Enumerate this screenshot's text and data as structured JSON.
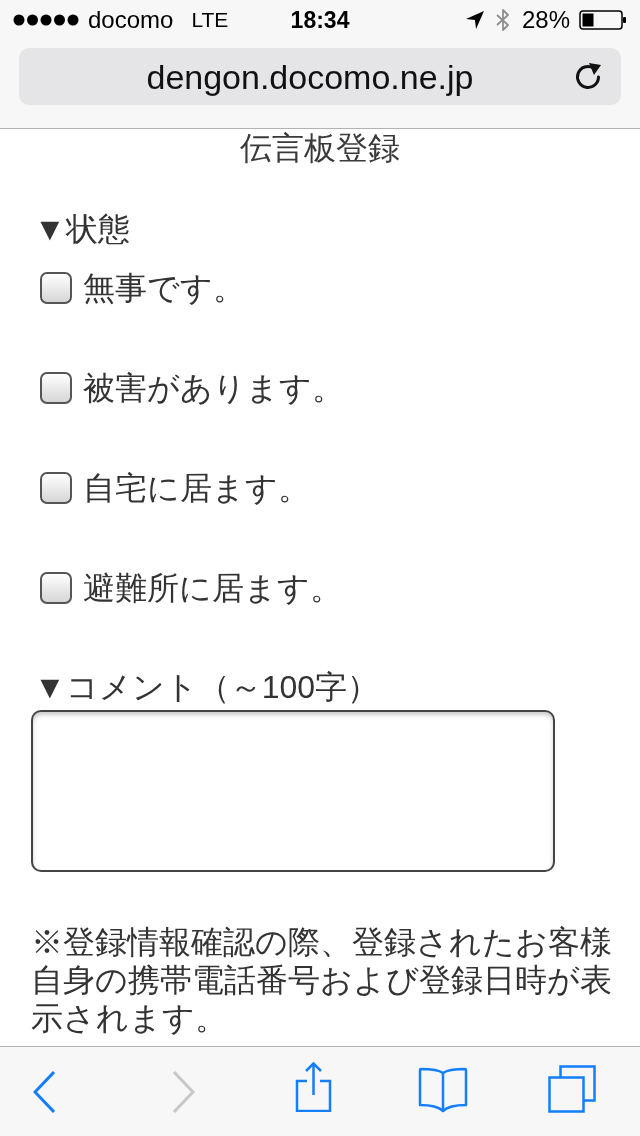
{
  "status_bar": {
    "carrier": "docomo",
    "network": "LTE",
    "time": "18:34",
    "battery": "28%"
  },
  "address_bar": {
    "url": "dengon.docomo.ne.jp"
  },
  "page": {
    "title": "伝言板登録",
    "status_heading": "▼状態",
    "status_options": [
      {
        "label": "無事です。",
        "checked": false
      },
      {
        "label": "被害があります。",
        "checked": false
      },
      {
        "label": "自宅に居ます。",
        "checked": false
      },
      {
        "label": "避難所に居ます。",
        "checked": false
      }
    ],
    "comment_heading": "▼コメント（～100字）",
    "notice": "※登録情報確認の際、登録されたお客様自身の携帯電話番号および登録日時が表示されます。"
  },
  "toolbar": {
    "back": {
      "disabled": false
    },
    "forward": {
      "disabled": true
    }
  }
}
